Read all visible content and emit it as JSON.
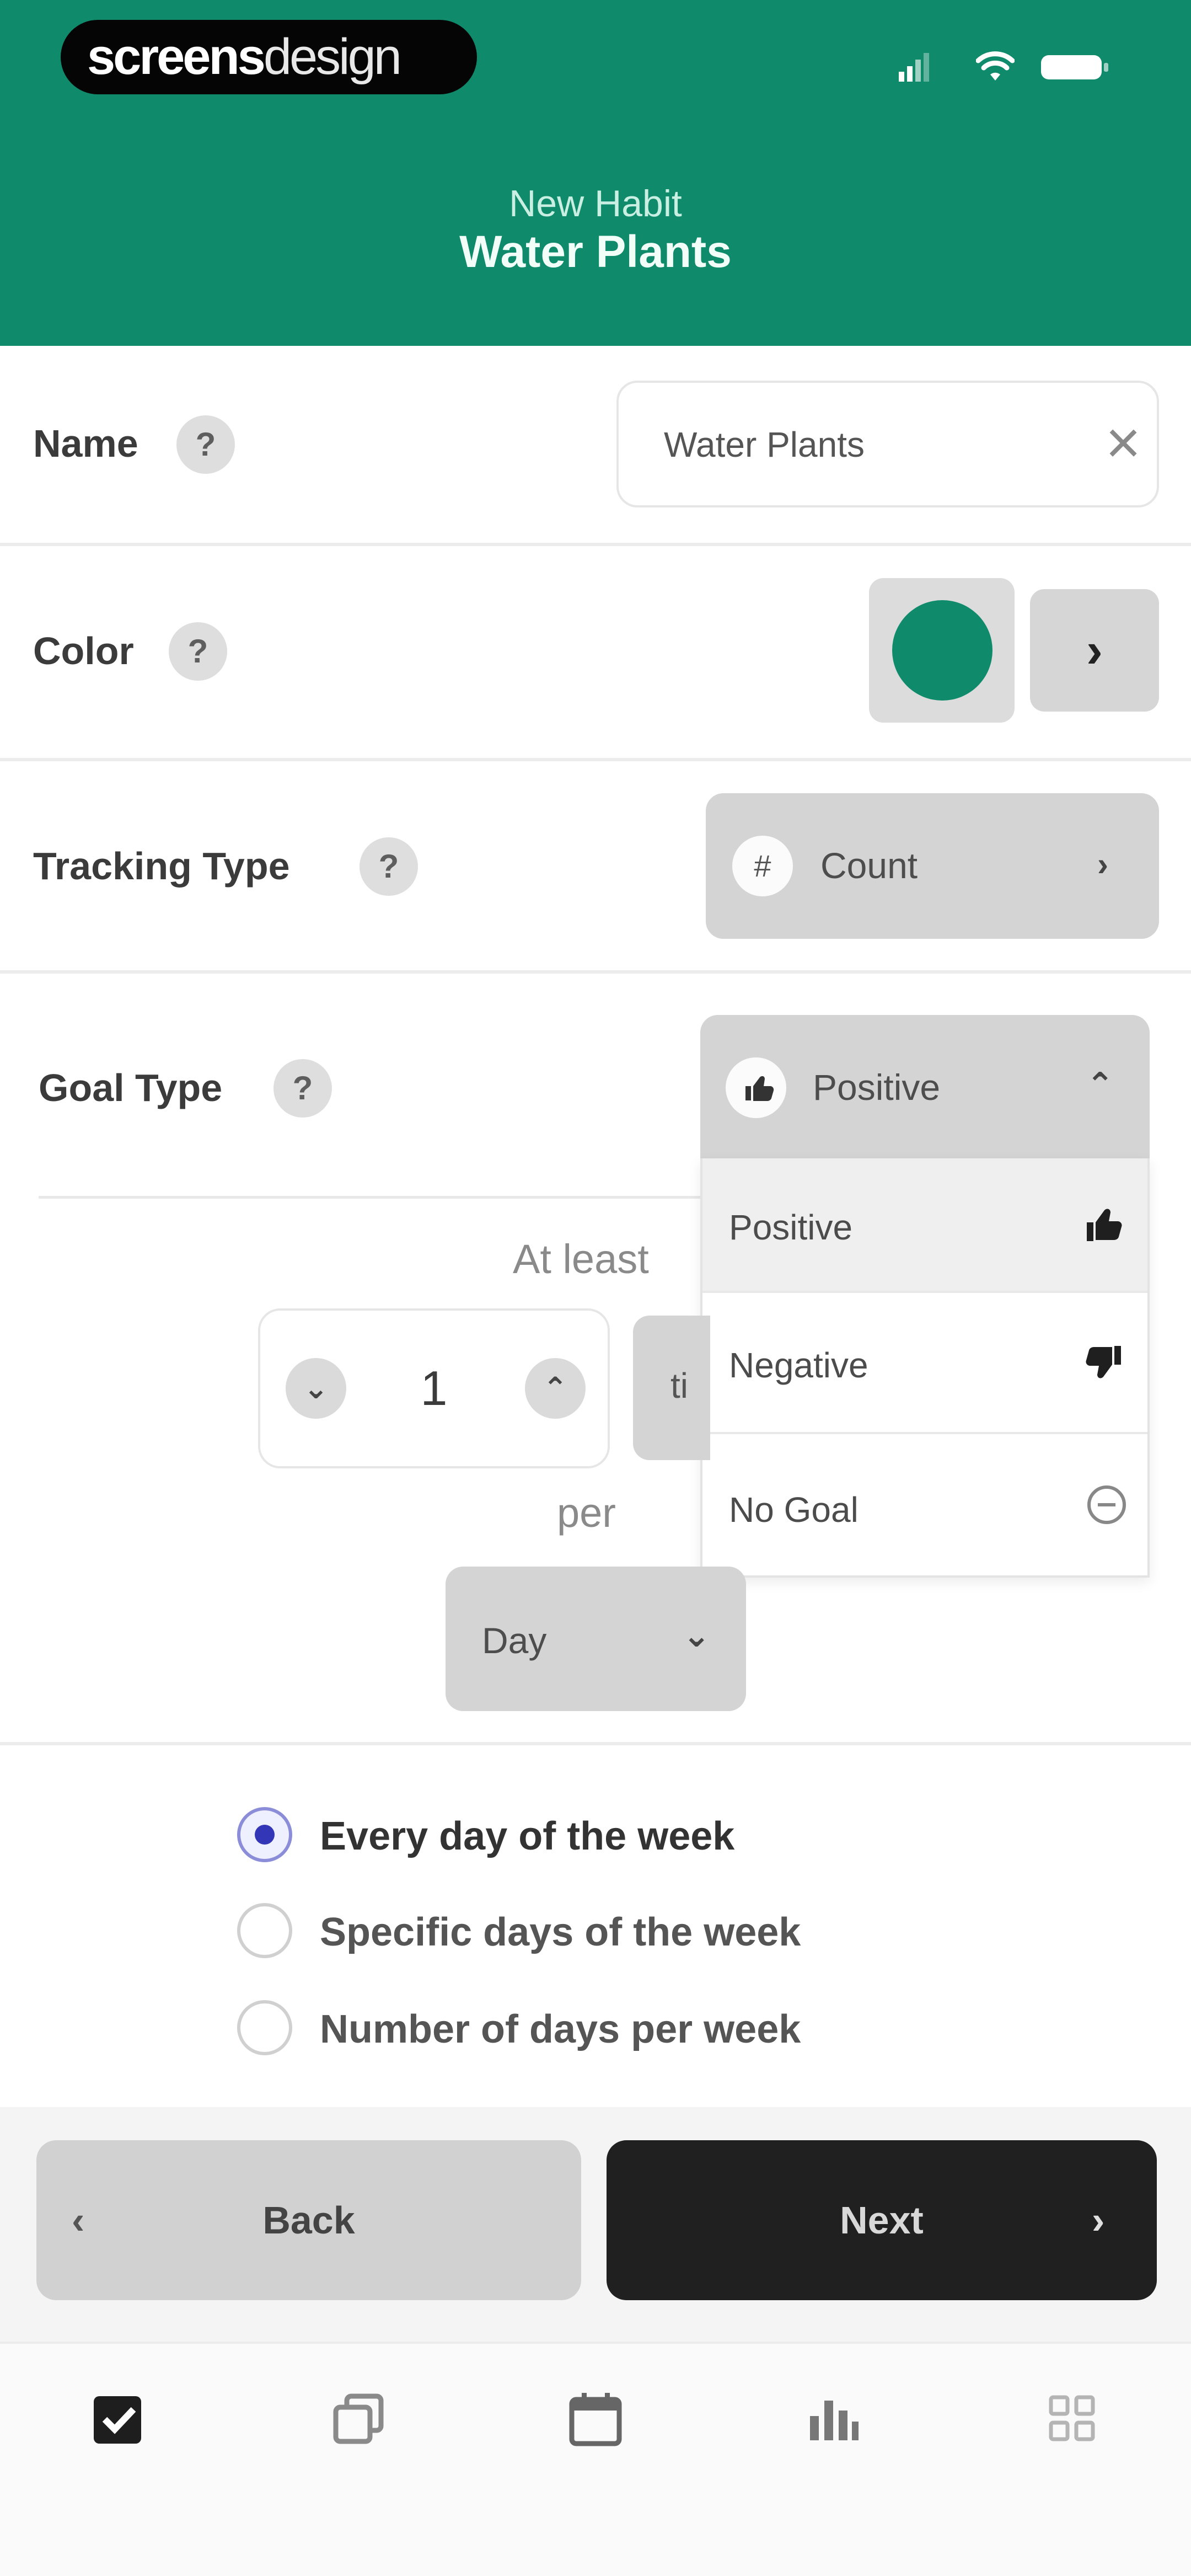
{
  "brand": {
    "bold": "screens",
    "light": "design"
  },
  "header": {
    "subtitle": "New Habit",
    "title": "Water Plants"
  },
  "colors": {
    "accent": "#0f8a6b",
    "radio_selected": "#3436b8",
    "dark_button": "#202020"
  },
  "form": {
    "name": {
      "label": "Name",
      "help": "?",
      "value": "Water Plants",
      "clear_icon": "close-icon"
    },
    "color": {
      "label": "Color",
      "help": "?",
      "selected_color": "#0f8a6b",
      "next": "›"
    },
    "tracking_type": {
      "label": "Tracking Type",
      "help": "?",
      "icon_glyph": "#",
      "value": "Count",
      "chevron": "›"
    },
    "goal_type": {
      "label": "Goal Type",
      "help": "?",
      "value": "Positive",
      "chevron": "⌃",
      "options": [
        {
          "label": "Positive",
          "icon": "thumbs-up-icon"
        },
        {
          "label": "Negative",
          "icon": "thumbs-down-icon"
        },
        {
          "label": "No Goal",
          "icon": "minus-circle-icon"
        }
      ]
    },
    "goal": {
      "at_least": "At least",
      "count": "1",
      "unit_partial": "ti",
      "per": "per",
      "period": "Day"
    },
    "frequency": {
      "options": [
        {
          "label": "Every day of the week",
          "selected": true
        },
        {
          "label": "Specific days of the week",
          "selected": false
        },
        {
          "label": "Number of days per week",
          "selected": false
        }
      ]
    }
  },
  "buttons": {
    "back": "Back",
    "next": "Next",
    "back_chevron": "‹",
    "next_chevron": "›"
  },
  "tabs": [
    "checklist-icon",
    "copy-icon",
    "calendar-icon",
    "stats-icon",
    "grid-icon"
  ]
}
